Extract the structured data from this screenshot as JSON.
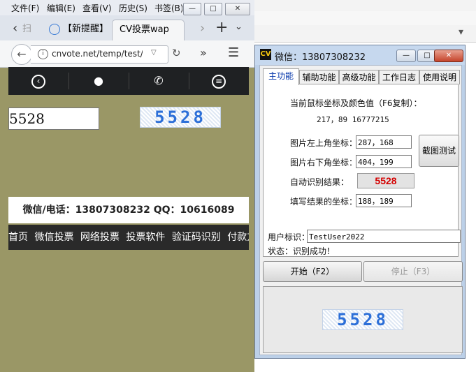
{
  "browser": {
    "menu": [
      "文件(F)",
      "编辑(E)",
      "查看(V)",
      "历史(S)",
      "书签(B)"
    ],
    "tabs": [
      {
        "label": "扫"
      },
      {
        "label": "【新提醒】"
      },
      {
        "label": "CV投票wap"
      }
    ],
    "url": "cnvote.net/temp/test/w"
  },
  "page": {
    "captcha_input_value": "5528",
    "captcha_image_text": "5528",
    "contact": "微信/电话：13807308232   QQ：10616089",
    "menu": [
      "首页",
      "微信投票",
      "网络投票",
      "投票软件",
      "验证码识别",
      "付款方式"
    ]
  },
  "tool": {
    "logo": "CV",
    "title": "微信：13807308232",
    "tabs": [
      "主功能",
      "辅助功能",
      "高级功能",
      "工作日志",
      "使用说明"
    ],
    "mouse_label": "当前鼠标坐标及颜色值（F6复制）：",
    "mouse_value": "217，89 16777215",
    "top_left_label": "图片左上角坐标：",
    "top_left_value": "287，168",
    "bottom_right_label": "图片右下角坐标：",
    "bottom_right_value": "404，199",
    "capture_button": "截图测试",
    "auto_result_label": "自动识别结果：",
    "auto_result_value": "5528",
    "fill_coord_label": "填写结果的坐标：",
    "fill_coord_value": "188，189",
    "user_label": "用户标识：",
    "user_value": "TestUser2022",
    "status_label": "状态：",
    "status_value": "识别成功！",
    "start_button": "开始（F2）",
    "stop_button": "停止（F3）",
    "preview_text": "5528"
  }
}
